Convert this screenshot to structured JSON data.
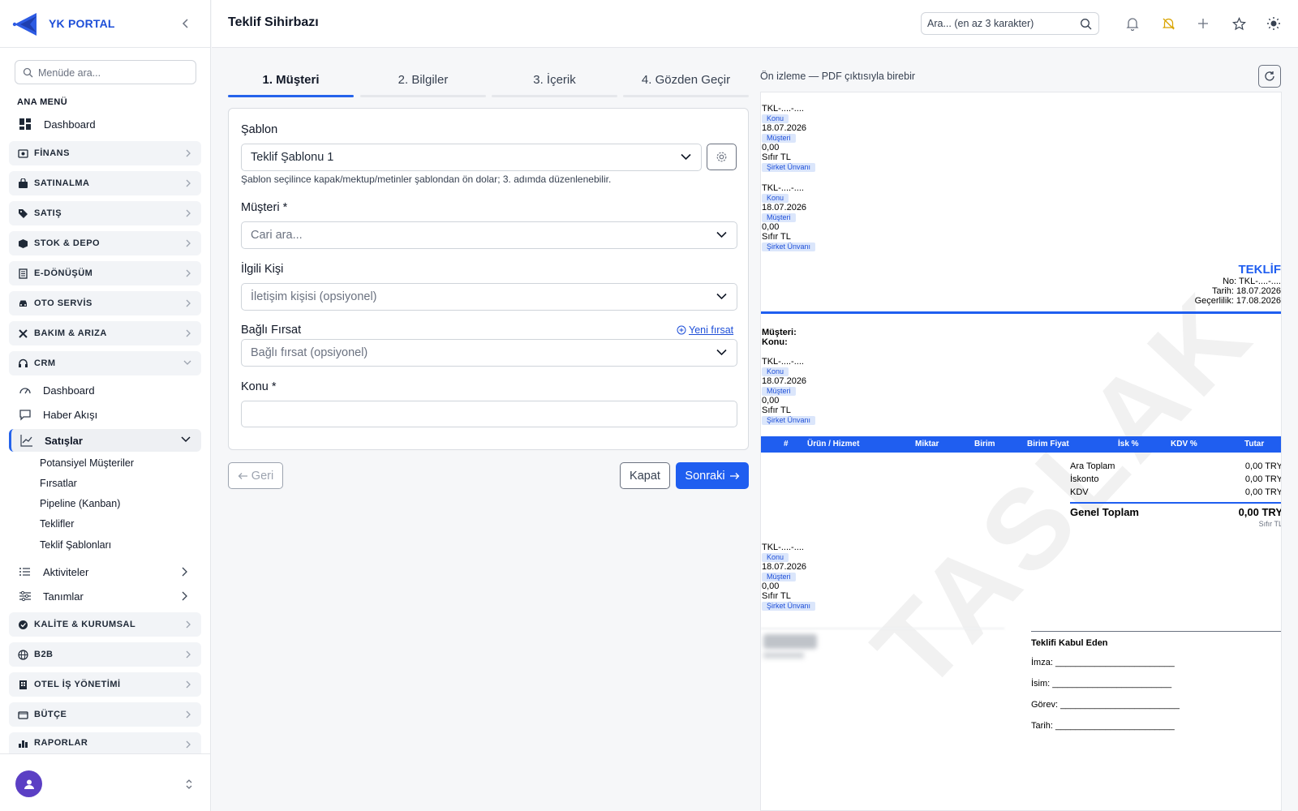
{
  "brand": {
    "name": "YK PORTAL"
  },
  "sidebar": {
    "search_placeholder": "Menüde ara...",
    "section": "ANA MENÜ",
    "dashboard": "Dashboard",
    "groups": [
      "FİNANS",
      "SATINALMA",
      "SATIŞ",
      "STOK & DEPO",
      "E-DÖNÜŞÜM",
      "OTO SERVİS",
      "BAKIM & ARIZA",
      "CRM"
    ],
    "crm_items": {
      "dashboard": "Dashboard",
      "feed": "Haber Akışı",
      "sales": "Satışlar"
    },
    "sales_items": [
      "Potansiyel Müşteriler",
      "Fırsatlar",
      "Pipeline (Kanban)",
      "Teklifler",
      "Teklif Şablonları"
    ],
    "crm_more": [
      "Aktiviteler",
      "Tanımlar"
    ],
    "groups_after": [
      "KALİTE & KURUMSAL",
      "B2B",
      "OTEL İŞ YÖNETİMİ",
      "BÜTÇE",
      "RAPORLAR"
    ]
  },
  "header": {
    "title": "Teklif Sihirbazı",
    "search_placeholder": "Ara... (en az 3 karakter)"
  },
  "wizard": {
    "tabs": [
      "1. Müşteri",
      "2. Bilgiler",
      "3. İçerik",
      "4. Gözden Geçir"
    ],
    "template_label": "Şablon",
    "template_value": "Teklif Şablonu 1",
    "template_hint": "Şablon seçilince kapak/mektup/metinler şablondan ön dolar; 3. adımda düzenlenebilir.",
    "customer_label": "Müşteri *",
    "customer_placeholder": "Cari ara...",
    "contact_label": "İlgili Kişi",
    "contact_placeholder": "İletişim kişisi (opsiyonel)",
    "opp_label": "Bağlı Fırsat",
    "opp_new": "Yeni fırsat",
    "opp_placeholder": "Bağlı fırsat (opsiyonel)",
    "subject_label": "Konu *",
    "subject_value": "",
    "back": "Geri",
    "close": "Kapat",
    "next": "Sonraki"
  },
  "preview": {
    "label": "Ön izleme — PDF çıktısıyla birebir",
    "watermark": "TASLAK",
    "block": {
      "no": "TKL-....-....",
      "konu": "Konu",
      "date": "18.07.2026",
      "musteri": "Müşteri",
      "amount": "0,00",
      "words": "Sıfır TL",
      "company": "Şirket Ünvanı"
    },
    "doc": {
      "title": "TEKLİF",
      "no": "No: TKL-....-....",
      "date": "Tarih: 18.07.2026",
      "validity": "Geçerlilik: 17.08.2026",
      "customer_lbl": "Müşteri:",
      "subject_lbl": "Konu:"
    },
    "table_headers": [
      "#",
      "Ürün / Hizmet",
      "Miktar",
      "Birim",
      "Birim Fiyat",
      "İsk %",
      "KDV %",
      "Tutar"
    ],
    "totals": {
      "subtotal_lbl": "Ara Toplam",
      "subtotal": "0,00 TRY",
      "discount_lbl": "İskonto",
      "discount": "0,00 TRY",
      "vat_lbl": "KDV",
      "vat": "0,00 TRY",
      "grand_lbl": "Genel Toplam",
      "grand": "0,00 TRY",
      "words": "Sıfır TL"
    },
    "sign": {
      "title": "Teklifi Kabul Eden",
      "imza": "İmza: ________________________",
      "isim": "İsim: ________________________",
      "gorev": "Görev: ________________________",
      "tarih": "Tarih: ________________________"
    }
  }
}
